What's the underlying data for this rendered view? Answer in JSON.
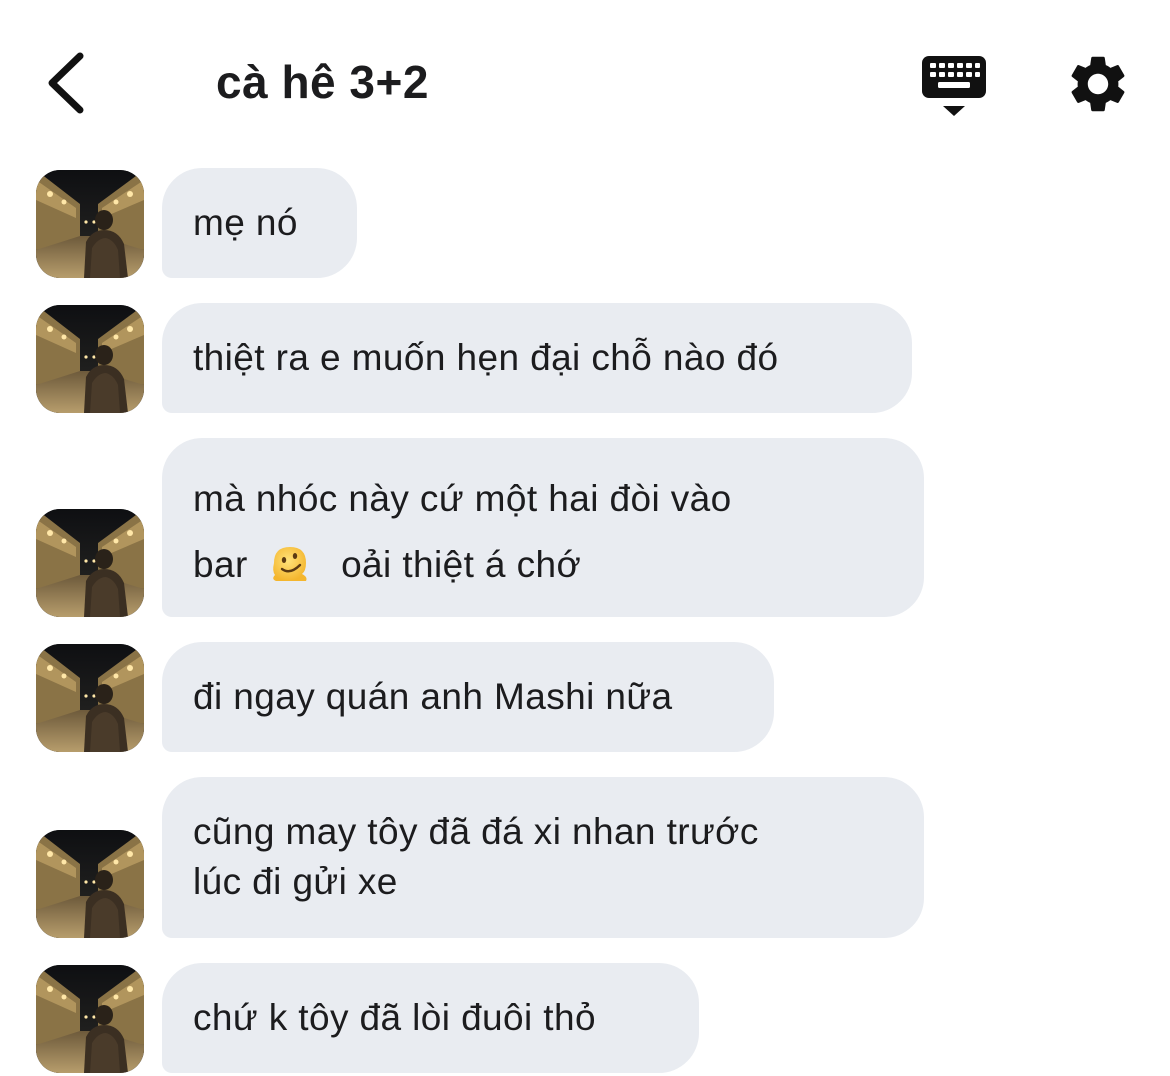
{
  "header": {
    "title": "cà hê 3+2",
    "back_icon": "chevron-left-icon",
    "keyboard_icon": "keyboard-hide-icon",
    "settings_icon": "gear-icon"
  },
  "messages": [
    {
      "text": "mẹ nó"
    },
    {
      "text": "thiệt ra e muốn hẹn đại chỗ nào đó"
    },
    {
      "line1": "mà nhóc này cứ một hai đòi vào",
      "line2_before": "bar",
      "emoji": "melting-face-emoji",
      "line2_after": "oải thiệt á chớ"
    },
    {
      "text": "đi ngay quán anh Mashi nữa"
    },
    {
      "line1": "cũng may tôy đã đá xi nhan trước",
      "line2": "lúc đi gửi xe"
    },
    {
      "text": "chứ k tôy đã lòi đuôi thỏ"
    }
  ],
  "colors": {
    "bubble": "#e9ecf1",
    "text": "#1c1c1e",
    "background": "#ffffff"
  }
}
